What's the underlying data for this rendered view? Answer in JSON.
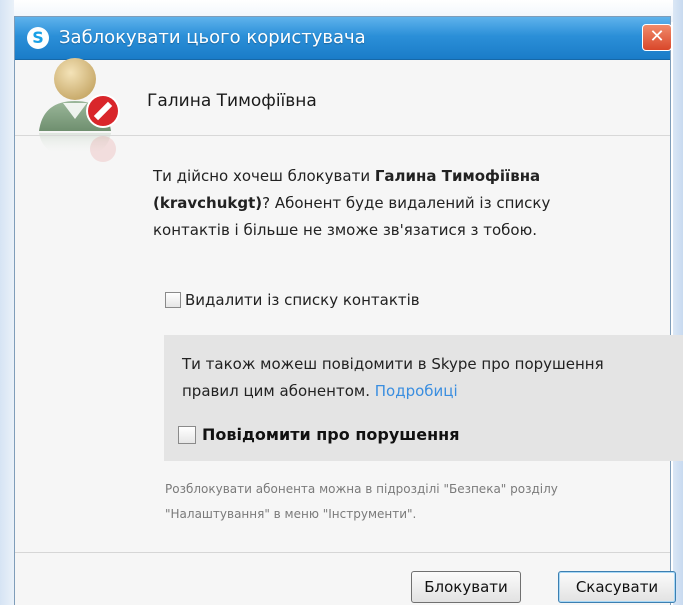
{
  "window": {
    "title": "Заблокувати цього користувача",
    "close_symbol": "✕"
  },
  "contact": {
    "name": "Галина Тимофіївна"
  },
  "question": {
    "prefix": "Ти дійсно хочеш блокувати ",
    "name_bold": "Галина Тимофіївна",
    "login_bold": "(kravchukgt)",
    "suffix": "? Абонент буде видалений із списку контактів і більше не зможе зв'язатися з тобою."
  },
  "remove_option": {
    "label": "Видалити із списку контактів",
    "checked": false
  },
  "report": {
    "text": "Ти також можеш повідомити в Skype про порушення правил цим абонентом.",
    "link_label": "Подробиці",
    "checkbox_label": "Повідомити про порушення",
    "checked": false
  },
  "footnote": "Розблокувати абонента можна в підрозділі \"Безпека\" розділу \"Налаштування\" в меню \"Інструменти\".",
  "buttons": {
    "block": "Блокувати",
    "cancel": "Скасувати"
  },
  "icons": {
    "app": "skype-icon",
    "avatar": "blocked-user-icon",
    "close": "close-icon"
  },
  "colors": {
    "titlebar": "#2b8fd8",
    "link": "#3a8ee0",
    "block_badge": "#d9262b"
  }
}
